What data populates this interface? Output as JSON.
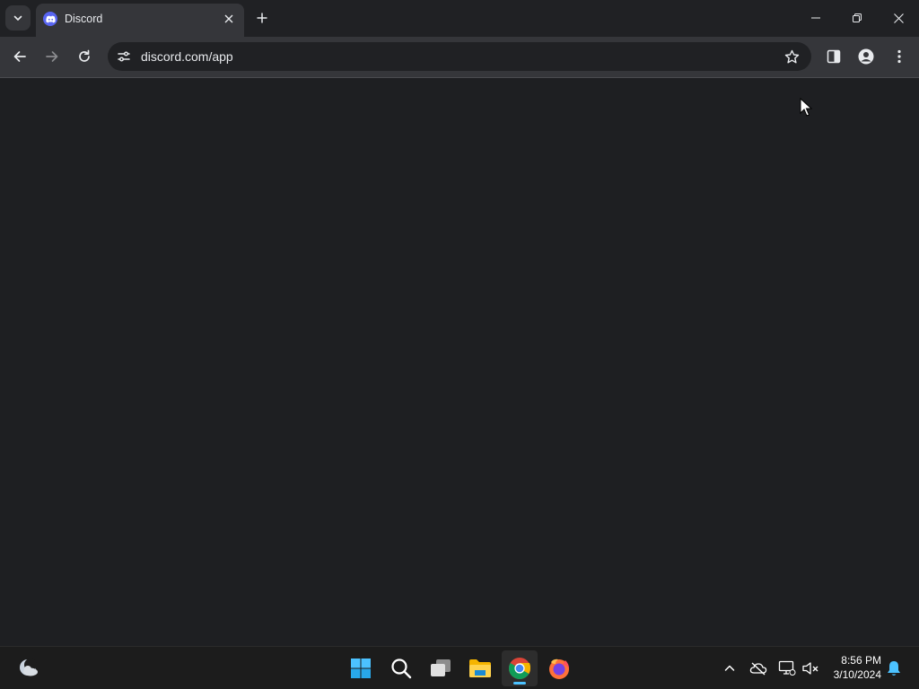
{
  "browser": {
    "tab": {
      "title": "Discord"
    },
    "address_bar": {
      "url": "discord.com/app"
    }
  },
  "taskbar": {
    "pinned": [
      "widgets-weather",
      "start",
      "search",
      "task-view",
      "file-explorer",
      "chrome",
      "firefox"
    ],
    "active_app": "chrome",
    "clock": {
      "time": "8:56 PM",
      "date": "3/10/2024"
    }
  },
  "colors": {
    "page_background": "#1e1f22",
    "tab_strip": "#202124",
    "toolbar": "#35363a",
    "discord_blurple": "#5865f2",
    "taskbar_active_indicator": "#4cc2ff"
  }
}
